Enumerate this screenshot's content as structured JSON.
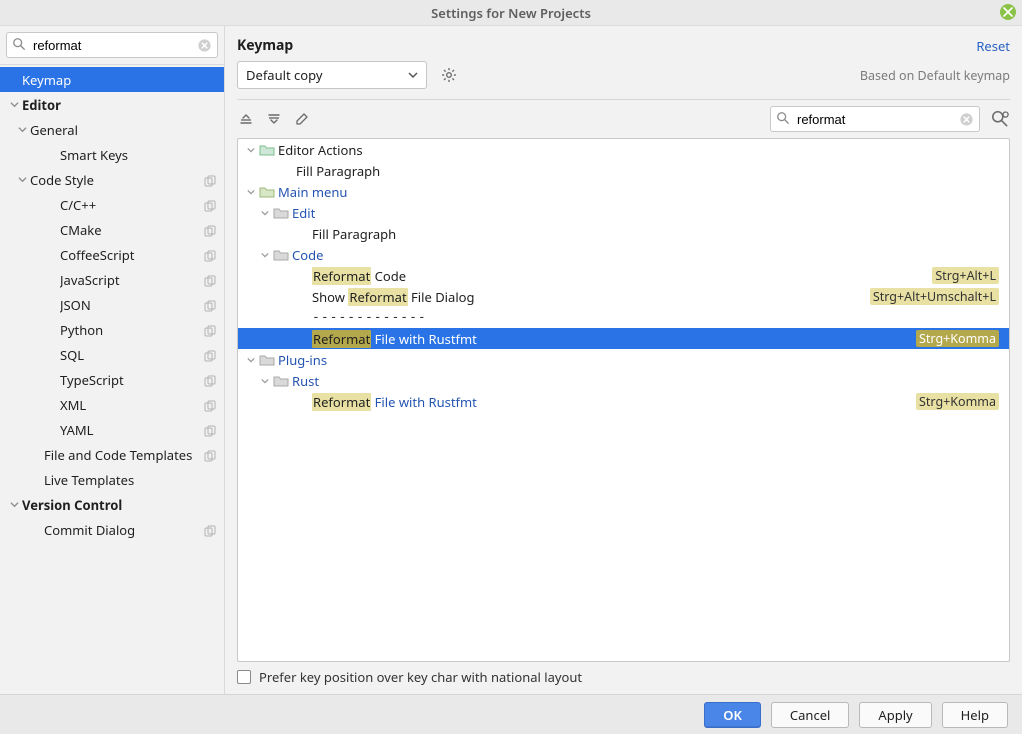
{
  "window": {
    "title": "Settings for New Projects"
  },
  "sidebar_search": {
    "value": "reformat",
    "placeholder": ""
  },
  "sidebar": {
    "items": [
      {
        "label": "Keymap"
      },
      {
        "label": "Editor"
      },
      {
        "label": "General"
      },
      {
        "label": "Smart Keys"
      },
      {
        "label": "Code Style"
      },
      {
        "label": "C/C++"
      },
      {
        "label": "CMake"
      },
      {
        "label": "CoffeeScript"
      },
      {
        "label": "JavaScript"
      },
      {
        "label": "JSON"
      },
      {
        "label": "Python"
      },
      {
        "label": "SQL"
      },
      {
        "label": "TypeScript"
      },
      {
        "label": "XML"
      },
      {
        "label": "YAML"
      },
      {
        "label": "File and Code Templates"
      },
      {
        "label": "Live Templates"
      },
      {
        "label": "Version Control"
      },
      {
        "label": "Commit Dialog"
      }
    ]
  },
  "right": {
    "heading": "Keymap",
    "reset": "Reset",
    "scheme": "Default copy",
    "based": "Based on Default keymap",
    "search": {
      "value": "reformat",
      "placeholder": ""
    },
    "tree": {
      "editor_actions": "Editor Actions",
      "fill_paragraph": "Fill Paragraph",
      "main_menu": "Main menu",
      "edit": "Edit",
      "code": "Code",
      "reformat_word": "Reformat",
      "reformat_code_rest": " Code",
      "show_prefix": "Show ",
      "file_dialog_rest": " File Dialog",
      "separator": "-------------",
      "file_rustfmt_rest": " File with Rustfmt",
      "plugins": "Plug-ins",
      "rust": "Rust",
      "sc_reformat_code": "Strg+Alt+L",
      "sc_show_dialog": "Strg+Alt+Umschalt+L",
      "sc_rustfmt": "Strg+Komma"
    },
    "prefer": "Prefer key position over key char with national layout"
  },
  "buttons": {
    "ok": "OK",
    "cancel": "Cancel",
    "apply": "Apply",
    "help": "Help"
  }
}
